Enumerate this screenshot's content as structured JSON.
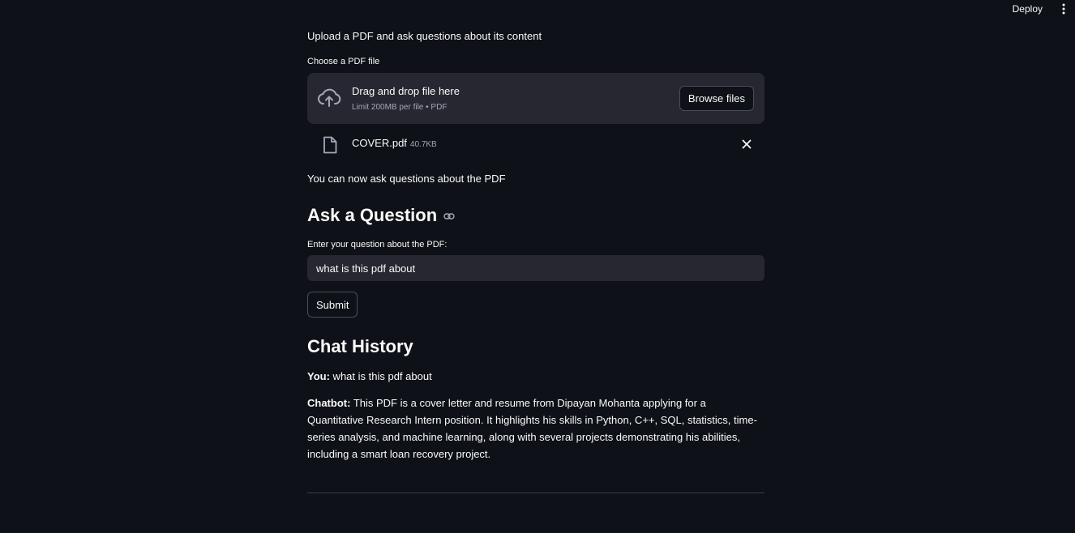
{
  "topbar": {
    "deploy_label": "Deploy",
    "menu_icon": "more-vertical-icon"
  },
  "intro_text": "Upload a PDF and ask questions about its content",
  "uploader": {
    "label": "Choose a PDF file",
    "drag_text": "Drag and drop file here",
    "limit_text": "Limit 200MB per file • PDF",
    "browse_label": "Browse files",
    "icon": "cloud-upload-icon"
  },
  "uploaded_file": {
    "name": "COVER.pdf",
    "size": "40.7KB",
    "icon": "file-icon",
    "remove_icon": "close-icon"
  },
  "status_text": "You can now ask questions about the PDF",
  "question_section": {
    "heading": "Ask a Question",
    "anchor_icon": "link-icon",
    "input_label": "Enter your question about the PDF:",
    "input_value": "what is this pdf about",
    "submit_label": "Submit"
  },
  "chat_history": {
    "heading": "Chat History",
    "messages": [
      {
        "speaker": "You",
        "separator": ":",
        "text": " what is this pdf about"
      },
      {
        "speaker": "Chatbot",
        "separator": ":",
        "text": " This PDF is a cover letter and resume from Dipayan Mohanta applying for a Quantitative Research Intern position. It highlights his skills in Python, C++, SQL, statistics, time-series analysis, and machine learning, along with several projects demonstrating his abilities, including a smart loan recovery project."
      }
    ]
  },
  "colors": {
    "background": "#0e1117",
    "panel": "#262730",
    "text": "#fafafa",
    "muted": "#a3a8b8"
  }
}
